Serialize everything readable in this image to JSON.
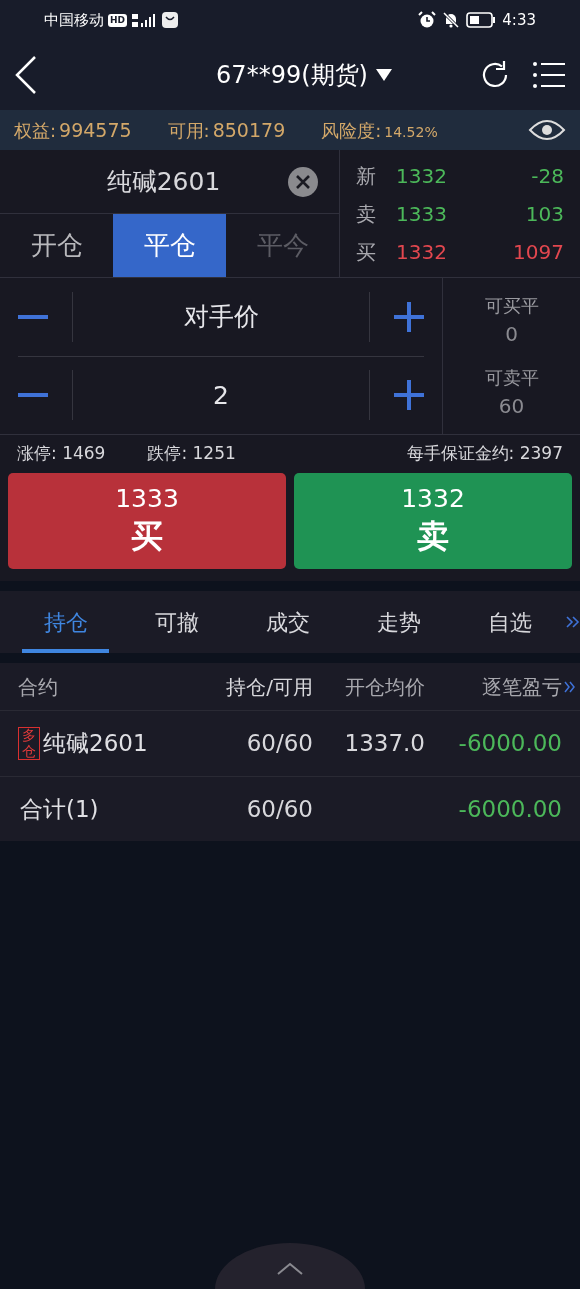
{
  "status_bar": {
    "carrier": "中国移动",
    "badge": "HD",
    "time": "4:33"
  },
  "header": {
    "title": "67**99(期货)"
  },
  "account": [
    {
      "label": "权益:",
      "value": "994575",
      "kind": "normal"
    },
    {
      "label": "可用:",
      "value": "850179",
      "kind": "normal"
    },
    {
      "label": "风险度:",
      "value": "14.52%",
      "kind": "small"
    }
  ],
  "symbol": "纯碱2601",
  "order_tabs": [
    {
      "label": "开仓",
      "selected": false,
      "disabled": false
    },
    {
      "label": "平仓",
      "selected": true,
      "disabled": false
    },
    {
      "label": "平今",
      "selected": false,
      "disabled": true
    }
  ],
  "quotes": [
    {
      "label": "新",
      "price": "1332",
      "change": "-28",
      "color": "#4cb85a"
    },
    {
      "label": "卖",
      "price": "1333",
      "change": "103",
      "color": "#4cb85a"
    },
    {
      "label": "买",
      "price": "1332",
      "change": "1097",
      "color": "#e2474f"
    }
  ],
  "price_field": {
    "value": "对手价"
  },
  "quantity_field": {
    "value": "2"
  },
  "closable": [
    {
      "label": "可买平",
      "value": "0"
    },
    {
      "label": "可卖平",
      "value": "60"
    }
  ],
  "limits": {
    "up": "涨停: 1469",
    "down": "跌停: 1251",
    "margin": "每手保证金约: 2397"
  },
  "trade_buttons": [
    {
      "kind": "buy",
      "price": "1333",
      "label": "买"
    },
    {
      "kind": "sell",
      "price": "1332",
      "label": "卖"
    }
  ],
  "bottom_tabs": [
    {
      "label": "持仓",
      "selected": true
    },
    {
      "label": "可撤",
      "selected": false
    },
    {
      "label": "成交",
      "selected": false
    },
    {
      "label": "走势",
      "selected": false
    },
    {
      "label": "自选",
      "selected": false
    }
  ],
  "table": {
    "columns": [
      "合约",
      "持仓/可用",
      "开仓均价",
      "逐笔盈亏"
    ],
    "rows": [
      {
        "badge": "多仓",
        "contract": "纯碱2601",
        "position": "60/60",
        "avg_price": "1337.0",
        "pnl": "-6000.00"
      }
    ],
    "total": {
      "label": "合计(1)",
      "position": "60/60",
      "pnl": "-6000.00"
    }
  }
}
